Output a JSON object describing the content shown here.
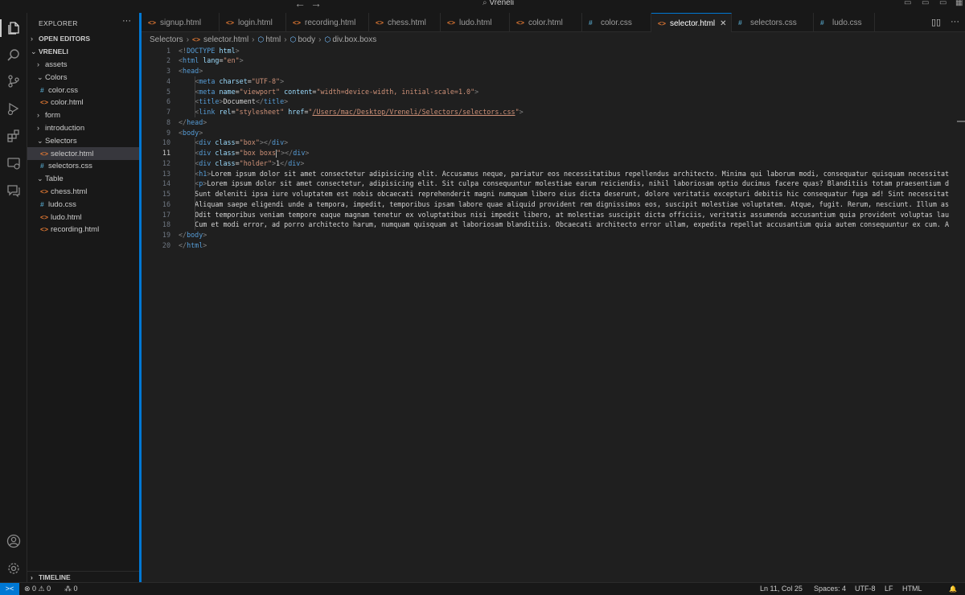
{
  "window": {
    "search_label": "Vreneli",
    "back_arrow": "←",
    "forward_arrow": "→"
  },
  "activity_icons": [
    "files-icon",
    "search-icon",
    "source-control-icon",
    "run-debug-icon",
    "extensions-icon",
    "remote-explorer-icon",
    "chat-icon",
    "account-icon",
    "gear-icon"
  ],
  "sidebar": {
    "title": "EXPLORER",
    "more": "···",
    "open_editors": "OPEN EDITORS",
    "root": "VRENELI",
    "items": [
      {
        "label": "assets",
        "type": "folder",
        "open": false,
        "depth": 1
      },
      {
        "label": "Colors",
        "type": "folder",
        "open": true,
        "depth": 1
      },
      {
        "label": "color.css",
        "type": "css",
        "depth": 2
      },
      {
        "label": "color.html",
        "type": "html",
        "depth": 2
      },
      {
        "label": "form",
        "type": "folder",
        "open": false,
        "depth": 1
      },
      {
        "label": "introduction",
        "type": "folder",
        "open": false,
        "depth": 1
      },
      {
        "label": "Selectors",
        "type": "folder",
        "open": true,
        "depth": 1
      },
      {
        "label": "selector.html",
        "type": "html",
        "depth": 2,
        "selected": true
      },
      {
        "label": "selectors.css",
        "type": "css",
        "depth": 2
      },
      {
        "label": "Table",
        "type": "folder",
        "open": true,
        "depth": 1
      },
      {
        "label": "chess.html",
        "type": "html",
        "depth": 2
      },
      {
        "label": "ludo.css",
        "type": "css",
        "depth": 2
      },
      {
        "label": "ludo.html",
        "type": "html",
        "depth": 2
      },
      {
        "label": "recording.html",
        "type": "html",
        "depth": 2
      }
    ],
    "timeline": "TIMELINE"
  },
  "tabs": [
    {
      "label": "signup.html",
      "type": "html"
    },
    {
      "label": "login.html",
      "type": "html"
    },
    {
      "label": "recording.html",
      "type": "html"
    },
    {
      "label": "chess.html",
      "type": "html"
    },
    {
      "label": "ludo.html",
      "type": "html"
    },
    {
      "label": "color.html",
      "type": "html"
    },
    {
      "label": "color.css",
      "type": "css"
    },
    {
      "label": "selector.html",
      "type": "html",
      "active": true
    },
    {
      "label": "selectors.css",
      "type": "css"
    },
    {
      "label": "ludo.css",
      "type": "css"
    }
  ],
  "breadcrumb": [
    "Selectors",
    "selector.html",
    "html",
    "body",
    "div.box.boxs"
  ],
  "editor": {
    "current_line": 11,
    "lines": [
      [
        [
          "t-punc",
          "<!"
        ],
        [
          "t-tag",
          "DOCTYPE "
        ],
        [
          "t-attr",
          "html"
        ],
        [
          "t-punc",
          ">"
        ]
      ],
      [
        [
          "t-punc",
          "<"
        ],
        [
          "t-tag",
          "html "
        ],
        [
          "t-attr",
          "lang"
        ],
        [
          "t-text",
          "="
        ],
        [
          "t-str",
          "\"en\""
        ],
        [
          "t-punc",
          ">"
        ]
      ],
      [
        [
          "t-punc",
          "<"
        ],
        [
          "t-tag",
          "head"
        ],
        [
          "t-punc",
          ">"
        ]
      ],
      [
        [
          "t-text",
          "    "
        ],
        [
          "t-punc",
          "<"
        ],
        [
          "t-tag",
          "meta "
        ],
        [
          "t-attr",
          "charset"
        ],
        [
          "t-text",
          "="
        ],
        [
          "t-str",
          "\"UTF-8\""
        ],
        [
          "t-punc",
          ">"
        ]
      ],
      [
        [
          "t-text",
          "    "
        ],
        [
          "t-punc",
          "<"
        ],
        [
          "t-tag",
          "meta "
        ],
        [
          "t-attr",
          "name"
        ],
        [
          "t-text",
          "="
        ],
        [
          "t-str",
          "\"viewport\" "
        ],
        [
          "t-attr",
          "content"
        ],
        [
          "t-text",
          "="
        ],
        [
          "t-str",
          "\"width=device-width, initial-scale=1.0\""
        ],
        [
          "t-punc",
          ">"
        ]
      ],
      [
        [
          "t-text",
          "    "
        ],
        [
          "t-punc",
          "<"
        ],
        [
          "t-tag",
          "title"
        ],
        [
          "t-punc",
          ">"
        ],
        [
          "t-text",
          "Document"
        ],
        [
          "t-punc",
          "</"
        ],
        [
          "t-tag",
          "title"
        ],
        [
          "t-punc",
          ">"
        ]
      ],
      [
        [
          "t-text",
          "    "
        ],
        [
          "t-punc",
          "<"
        ],
        [
          "t-tag",
          "link "
        ],
        [
          "t-attr",
          "rel"
        ],
        [
          "t-text",
          "="
        ],
        [
          "t-str",
          "\"stylesheet\" "
        ],
        [
          "t-attr",
          "href"
        ],
        [
          "t-text",
          "="
        ],
        [
          "t-str",
          "\""
        ],
        [
          "t-url",
          "/Users/mac/Desktop/Vreneli/Selectors/selectors.css"
        ],
        [
          "t-str",
          "\""
        ],
        [
          "t-punc",
          ">"
        ]
      ],
      [
        [
          "t-punc",
          "</"
        ],
        [
          "t-tag",
          "head"
        ],
        [
          "t-punc",
          ">"
        ]
      ],
      [
        [
          "t-punc",
          "<"
        ],
        [
          "t-tag",
          "body"
        ],
        [
          "t-punc",
          ">"
        ]
      ],
      [
        [
          "t-text",
          "    "
        ],
        [
          "t-punc",
          "<"
        ],
        [
          "t-tag",
          "div "
        ],
        [
          "t-attr",
          "class"
        ],
        [
          "t-text",
          "="
        ],
        [
          "t-str",
          "\"box\""
        ],
        [
          "t-punc",
          "></"
        ],
        [
          "t-tag",
          "div"
        ],
        [
          "t-punc",
          ">"
        ]
      ],
      [
        [
          "t-text",
          "    "
        ],
        [
          "t-punc",
          "<"
        ],
        [
          "t-tag",
          "div "
        ],
        [
          "t-attr",
          "class"
        ],
        [
          "t-text",
          "="
        ],
        [
          "t-str",
          "\"box boxs"
        ],
        [
          "cursor",
          ""
        ],
        [
          "t-str",
          "\""
        ],
        [
          "t-punc",
          "></"
        ],
        [
          "t-tag",
          "div"
        ],
        [
          "t-punc",
          ">"
        ]
      ],
      [
        [
          "t-text",
          "    "
        ],
        [
          "t-punc",
          "<"
        ],
        [
          "t-tag",
          "div "
        ],
        [
          "t-attr",
          "class"
        ],
        [
          "t-text",
          "="
        ],
        [
          "t-str",
          "\"holder\""
        ],
        [
          "t-punc",
          ">"
        ],
        [
          "t-text",
          "1"
        ],
        [
          "t-punc",
          "</"
        ],
        [
          "t-tag",
          "div"
        ],
        [
          "t-punc",
          ">"
        ]
      ],
      [
        [
          "t-text",
          "    "
        ],
        [
          "t-punc",
          "<"
        ],
        [
          "t-tag",
          "h1"
        ],
        [
          "t-punc",
          ">"
        ],
        [
          "t-text",
          "Lorem ipsum dolor sit amet consectetur adipisicing elit. Accusamus neque, pariatur eos necessitatibus repellendus architecto. Minima qui laborum modi, consequatur quisquam necessitat"
        ]
      ],
      [
        [
          "t-text",
          "    "
        ],
        [
          "t-punc",
          "<"
        ],
        [
          "t-tag",
          "p"
        ],
        [
          "t-punc",
          ">"
        ],
        [
          "t-text",
          "Lorem ipsum dolor sit amet consectetur, adipisicing elit. Sit culpa consequuntur molestiae earum reiciendis, nihil laboriosam optio ducimus facere quas? Blanditiis totam praesentium d"
        ]
      ],
      [
        [
          "t-text",
          "    Sunt deleniti ipsa iure voluptatem est nobis obcaecati reprehenderit magni numquam libero eius dicta deserunt, dolore veritatis excepturi debitis hic consequatur fuga ad! Sint necessitat"
        ]
      ],
      [
        [
          "t-text",
          "    Aliquam saepe eligendi unde a tempora, impedit, temporibus ipsam labore quae aliquid provident rem dignissimos eos, suscipit molestiae voluptatem. Atque, fugit. Rerum, nesciunt. Illum as"
        ]
      ],
      [
        [
          "t-text",
          "    Odit temporibus veniam tempore eaque magnam tenetur ex voluptatibus nisi impedit libero, at molestias suscipit dicta officiis, veritatis assumenda accusantium quia provident voluptas lau"
        ]
      ],
      [
        [
          "t-text",
          "    Cum et modi error, ad porro architecto harum, numquam quisquam at laboriosam blanditiis. Obcaecati architecto error ullam, expedita repellat accusantium quia autem consequuntur ex cum. A"
        ]
      ],
      [
        [
          "t-punc",
          "</"
        ],
        [
          "t-tag",
          "body"
        ],
        [
          "t-punc",
          ">"
        ]
      ],
      [
        [
          "t-punc",
          "</"
        ],
        [
          "t-tag",
          "html"
        ],
        [
          "t-punc",
          ">"
        ]
      ]
    ]
  },
  "status": {
    "remote": "><",
    "problems": "⊗ 0 ⚠ 0",
    "ports": "⁂ 0",
    "position": "Ln 11, Col 25",
    "spaces": "Spaces: 4",
    "encoding": "UTF-8",
    "eol": "LF",
    "language": "HTML",
    "bell": "🔔"
  },
  "colors": {
    "accent": "#0078d4",
    "html_icon": "#e37933",
    "css_icon": "#519aba"
  }
}
